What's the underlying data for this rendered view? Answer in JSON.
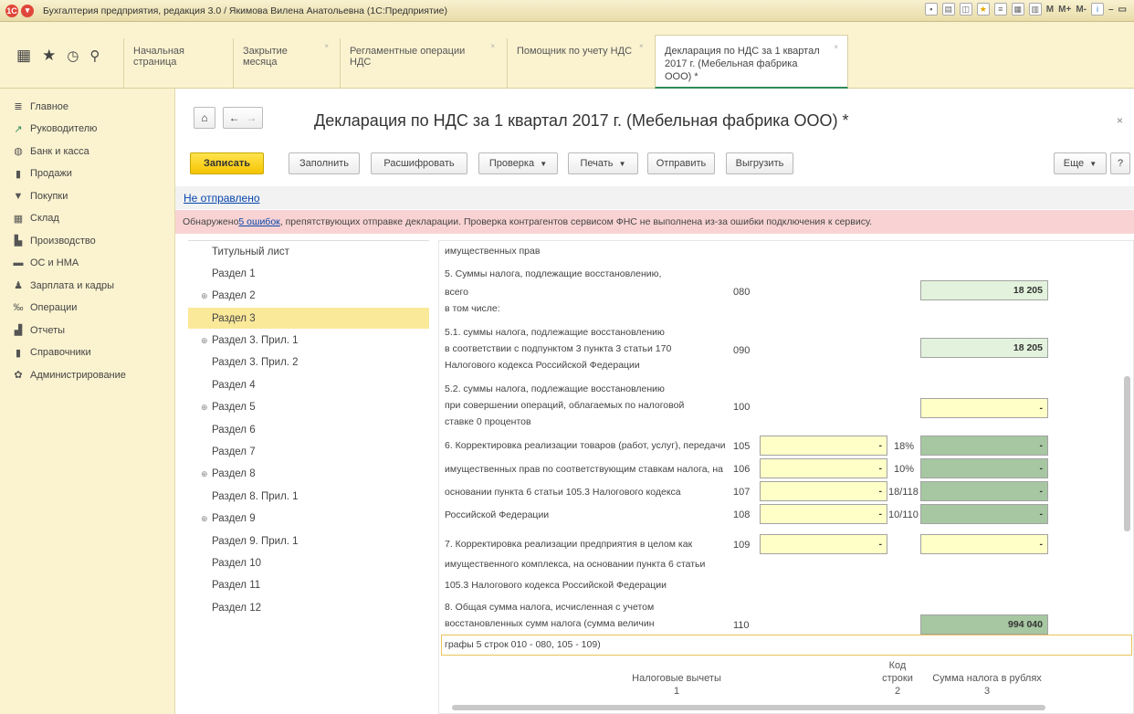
{
  "window": {
    "title": "Бухгалтерия предприятия, редакция 3.0 / Якимова Вилена Анатольевна  (1С:Предприятие)",
    "toolbar_m": [
      "M",
      "M+",
      "M-"
    ]
  },
  "tabs": [
    {
      "label": "Начальная страница",
      "closable": false
    },
    {
      "label": "Закрытие месяца",
      "closable": true
    },
    {
      "label": "Регламентные операции НДС",
      "closable": true
    },
    {
      "label": "Помощник по учету НДС",
      "closable": true
    },
    {
      "label_line1": "Декларация по НДС за 1 квартал",
      "label_line2": "2017 г. (Мебельная фабрика ООО) *",
      "closable": true,
      "active": true
    }
  ],
  "sidebar": {
    "items": [
      {
        "label": "Главное",
        "icon": "menu-icon"
      },
      {
        "label": "Руководителю",
        "icon": "chart-line-icon"
      },
      {
        "label": "Банк и касса",
        "icon": "bank-icon"
      },
      {
        "label": "Продажи",
        "icon": "sales-icon"
      },
      {
        "label": "Покупки",
        "icon": "cart-icon"
      },
      {
        "label": "Склад",
        "icon": "warehouse-icon"
      },
      {
        "label": "Производство",
        "icon": "factory-icon"
      },
      {
        "label": "ОС и НМА",
        "icon": "truck-icon"
      },
      {
        "label": "Зарплата и кадры",
        "icon": "person-icon"
      },
      {
        "label": "Операции",
        "icon": "operations-icon"
      },
      {
        "label": "Отчеты",
        "icon": "reports-icon"
      },
      {
        "label": "Справочники",
        "icon": "book-icon"
      },
      {
        "label": "Администрирование",
        "icon": "gear-icon"
      }
    ]
  },
  "document": {
    "title": "Декларация по НДС за 1 квартал 2017 г. (Мебельная фабрика ООО) *",
    "status": "Не отправлено",
    "error_prefix": "Обнаружено ",
    "error_link": "5 ошибок",
    "error_suffix": ", препятствующих отправке декларации. Проверка контрагентов сервисом ФНС не выполнена из-за ошибки подключения к сервису."
  },
  "toolbar": {
    "save": "Записать",
    "fill": "Заполнить",
    "decode": "Расшифровать",
    "check": "Проверка",
    "print": "Печать",
    "send": "Отправить",
    "upload": "Выгрузить",
    "more": "Еще",
    "help": "?"
  },
  "tree": [
    {
      "label": "Титульный лист",
      "plus": false
    },
    {
      "label": "Раздел 1",
      "plus": false
    },
    {
      "label": "Раздел 2",
      "plus": true
    },
    {
      "label": "Раздел 3",
      "plus": false,
      "selected": true
    },
    {
      "label": "Раздел 3. Прил. 1",
      "plus": true
    },
    {
      "label": "Раздел 3. Прил. 2",
      "plus": false
    },
    {
      "label": "Раздел 4",
      "plus": false
    },
    {
      "label": "Раздел 5",
      "plus": true
    },
    {
      "label": "Раздел 6",
      "plus": false
    },
    {
      "label": "Раздел 7",
      "plus": false
    },
    {
      "label": "Раздел 8",
      "plus": true
    },
    {
      "label": "Раздел 8. Прил. 1",
      "plus": false
    },
    {
      "label": "Раздел 9",
      "plus": true
    },
    {
      "label": "Раздел 9. Прил. 1",
      "plus": false
    },
    {
      "label": "Раздел 10",
      "plus": false
    },
    {
      "label": "Раздел 11",
      "plus": false
    },
    {
      "label": "Раздел 12",
      "plus": false
    }
  ],
  "form": {
    "t0": "имущественных прав",
    "t5a": "5. Суммы налога, подлежащие восстановлению,",
    "t5b": "всего",
    "t5c": "в том числе:",
    "c080": "080",
    "v080": "18 205",
    "t51a": "5.1. суммы налога, подлежащие восстановлению",
    "t51b": "в соответствии с подпунктом 3 пункта 3 статьи 170",
    "t51c": "Налогового кодекса Российской Федерации",
    "c090": "090",
    "v090": "18 205",
    "t52a": "5.2. суммы налога, подлежащие восстановлению",
    "t52b": "при совершении операций, облагаемых по налоговой",
    "t52c": "ставке 0 процентов",
    "c100": "100",
    "v100": "-",
    "t6a": "6. Корректировка реализации товаров (работ, услуг), передачи",
    "t6b": "имущественных прав по соответствующим ставкам налога, на",
    "t6c": "основании пункта 6 статьи 105.3 Налогового кодекса",
    "t6d": "Российской Федерации",
    "c105": "105",
    "c106": "106",
    "c107": "107",
    "c108": "108",
    "p105": "18%",
    "p106": "10%",
    "p107": "18/118",
    "p108": "10/110",
    "dash": "-",
    "t7a": "7. Корректировка реализации предприятия в целом как",
    "t7b": "имущественного комплекса, на основании пункта 6 статьи",
    "t7c": "105.3 Налогового кодекса Российской Федерации",
    "c109": "109",
    "t8a": "8. Общая сумма налога, исчисленная с учетом",
    "t8b": "восстановленных сумм налога (сумма величин",
    "t8c": "графы 5 строк 010 - 080, 105 - 109)",
    "c110": "110",
    "v110": "994 040",
    "col1": "Налоговые вычеты",
    "col1n": "1",
    "col2a": "Код",
    "col2b": "строки",
    "col2n": "2",
    "col3": "Сумма налога в рублях",
    "col3n": "3"
  }
}
